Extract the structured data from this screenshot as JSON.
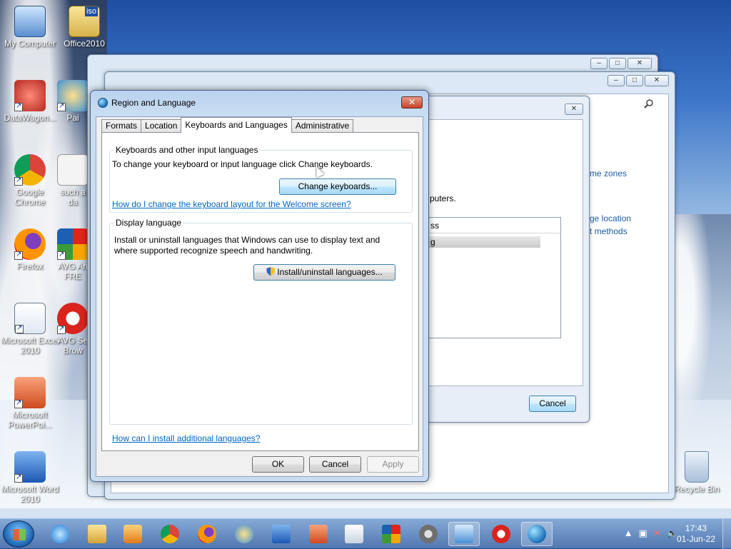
{
  "desktop": {
    "icons": [
      {
        "label": "My Computer",
        "icon": "computer-icon"
      },
      {
        "label": "Office2010",
        "icon": "iso-icon",
        "badge": "iso"
      },
      {
        "label": "DataWagon...",
        "icon": "datawagon-icon"
      },
      {
        "label": "Pai",
        "icon": "paint-icon"
      },
      {
        "label": "Google Chrome",
        "icon": "chrome-icon"
      },
      {
        "label": "such a da",
        "icon": "document-icon"
      },
      {
        "label": "Firefox",
        "icon": "firefox-icon"
      },
      {
        "label": "AVG An FRE",
        "icon": "avg-icon"
      },
      {
        "label": "Microsoft Excel 2010",
        "icon": "excel-icon"
      },
      {
        "label": "AVG Se Brow",
        "icon": "avg-browser-icon"
      },
      {
        "label": "Microsoft PowerPoi...",
        "icon": "powerpoint-icon"
      },
      {
        "label": "Microsoft Word 2010",
        "icon": "word-icon"
      },
      {
        "label": "Recycle Bin",
        "icon": "recycle-bin-icon"
      }
    ]
  },
  "background_window": {
    "links": [
      "me zones",
      "ge location",
      "t methods"
    ],
    "text_fragment": "puters.",
    "list_header": "ss",
    "list_item": "g",
    "cancel_label": "Cancel"
  },
  "dialog": {
    "title": "Region and Language",
    "close_glyph": "✕",
    "tabs": [
      "Formats",
      "Location",
      "Keyboards and Languages",
      "Administrative"
    ],
    "active_tab": "Keyboards and Languages",
    "keyboards_group": {
      "legend": "Keyboards and other input languages",
      "description": "To change your keyboard or input language click Change keyboards.",
      "button": "Change keyboards...",
      "link": "How do I change the keyboard layout for the Welcome screen?"
    },
    "display_group": {
      "legend": "Display language",
      "description_line1": "Install or uninstall languages that Windows can use to display text and",
      "description_line2": "where supported recognize speech and handwriting.",
      "button": "Install/uninstall languages..."
    },
    "bottom_link": "How can I install additional languages?",
    "buttons": {
      "ok": "OK",
      "cancel": "Cancel",
      "apply": "Apply"
    }
  },
  "taskbar": {
    "pinned": [
      "ie-icon",
      "explorer-icon",
      "media-player-icon",
      "chrome-icon",
      "firefox-icon",
      "paint-icon",
      "word-icon",
      "powerpoint-icon",
      "solitaire-icon",
      "avg-icon",
      "settings-gear-icon",
      "control-panel-icon",
      "avg-browser-icon",
      "region-globe-icon"
    ],
    "clock_time": "17:43",
    "clock_date": "01-Jun-22"
  }
}
